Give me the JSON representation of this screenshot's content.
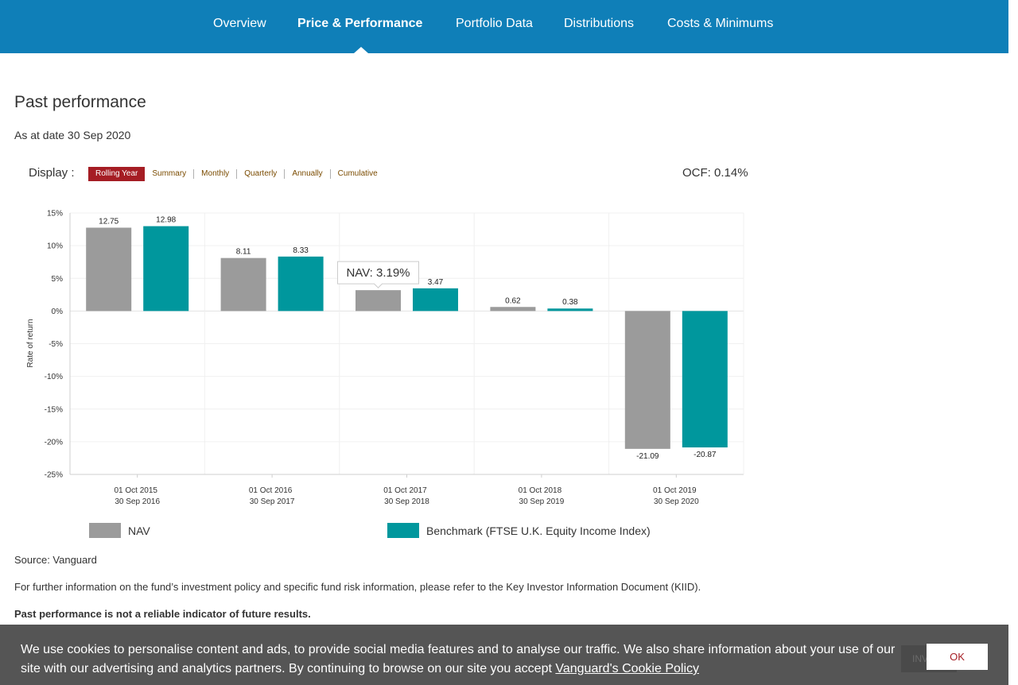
{
  "nav": {
    "tabs": [
      {
        "label": "Overview"
      },
      {
        "label": "Price & Performance"
      },
      {
        "label": "Portfolio Data"
      },
      {
        "label": "Distributions"
      },
      {
        "label": "Costs & Minimums"
      }
    ],
    "active_tab": "Price & Performance"
  },
  "section": {
    "title": "Past performance",
    "as_at": "As at date 30 Sep 2020"
  },
  "display": {
    "label": "Display :",
    "options": [
      "Rolling Year",
      "Summary",
      "Monthly",
      "Quarterly",
      "Annually",
      "Cumulative"
    ],
    "selected": "Rolling Year"
  },
  "ocf": "OCF: 0.14%",
  "tooltip": "NAV: 3.19%",
  "colors": {
    "nav_blue": "#0f7fb8",
    "nav_series": "#9b9b9b",
    "benchmark_series": "#00979d",
    "active_option": "#a51d24"
  },
  "chart_data": {
    "type": "bar",
    "ylabel": "Rate of return",
    "ylim": [
      -25,
      15
    ],
    "yticks": [
      15,
      10,
      5,
      0,
      -5,
      -10,
      -15,
      -20,
      -25
    ],
    "ytick_labels": [
      "15%",
      "10%",
      "5%",
      "0%",
      "-5%",
      "-10%",
      "-15%",
      "-20%",
      "-25%"
    ],
    "grid": true,
    "legend_position": "bottom",
    "categories": [
      {
        "start": "01 Oct 2015",
        "end": "30 Sep 2016"
      },
      {
        "start": "01 Oct 2016",
        "end": "30 Sep 2017"
      },
      {
        "start": "01 Oct 2017",
        "end": "30 Sep 2018"
      },
      {
        "start": "01 Oct 2018",
        "end": "30 Sep 2019"
      },
      {
        "start": "01 Oct 2019",
        "end": "30 Sep 2020"
      }
    ],
    "series": [
      {
        "name": "NAV",
        "values": [
          12.75,
          8.11,
          3.19,
          0.62,
          -21.09
        ],
        "labels": [
          "12.75",
          "8.11",
          "",
          "0.62",
          "-21.09"
        ]
      },
      {
        "name": "Benchmark (FTSE U.K. Equity Income Index)",
        "values": [
          12.98,
          8.33,
          3.47,
          0.38,
          -20.87
        ],
        "labels": [
          "12.98",
          "8.33",
          "3.47",
          "0.38",
          "-20.87"
        ]
      }
    ]
  },
  "footer": {
    "source": "Source: Vanguard",
    "further": "For further information on the fund’s investment policy and specific fund risk information, please refer to the Key Investor Information Document (KIID).",
    "disclaimer": "Past performance is not a reliable indicator of future results."
  },
  "cookie": {
    "text": "We use cookies to personalise content and ads, to provide social media features and to analyse our traffic. We also share information about your use of our site with our advertising and analytics partners. By continuing to browse on our site you accept",
    "link": "Vanguard's Cookie Policy",
    "ghost_button": "INVEST",
    "ok_button": "OK"
  }
}
